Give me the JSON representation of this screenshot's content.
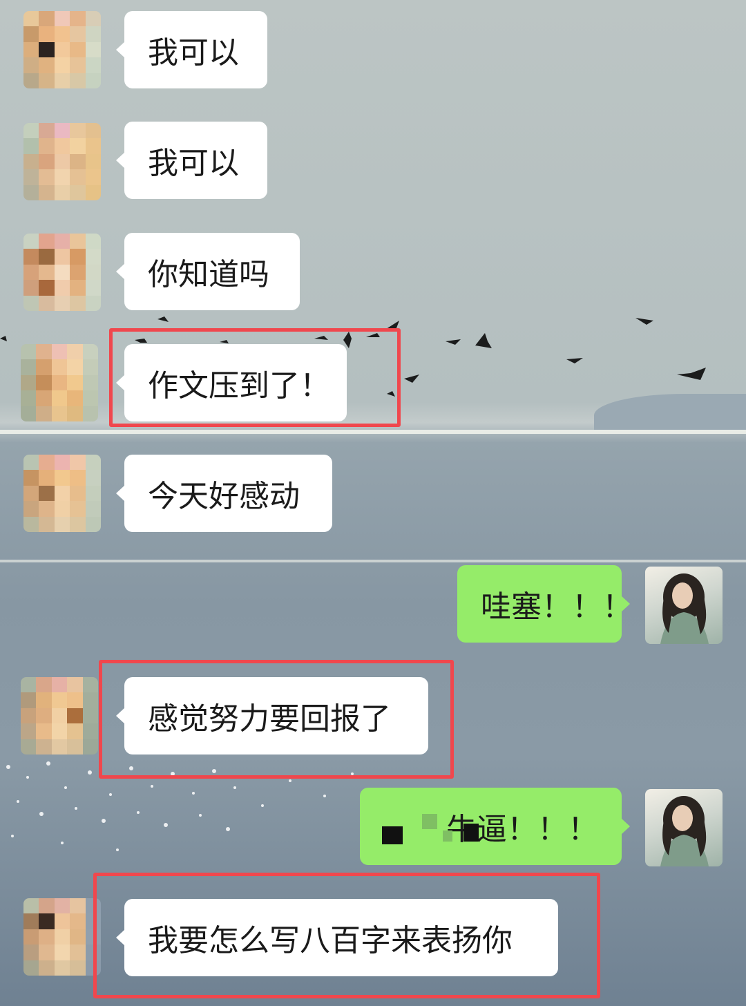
{
  "chat": {
    "messages": [
      {
        "side": "left",
        "text": "我可以"
      },
      {
        "side": "left",
        "text": "我可以"
      },
      {
        "side": "left",
        "text": "你知道吗"
      },
      {
        "side": "left",
        "text": "作文压到了！",
        "highlighted": true
      },
      {
        "side": "left",
        "text": "今天好感动"
      },
      {
        "side": "right",
        "text": "哇塞！！！"
      },
      {
        "side": "left",
        "text": "感觉努力要回报了",
        "highlighted": true
      },
      {
        "side": "right",
        "text": "牛逼！！！",
        "partially_redacted": true
      },
      {
        "side": "left",
        "text": "我要怎么写八百字来表扬你",
        "highlighted": true
      }
    ]
  },
  "colors": {
    "incoming_bubble": "#ffffff",
    "outgoing_bubble": "#95ec69",
    "highlight_box": "#f0474d"
  },
  "icons": {
    "contact_avatar": "pixelated-avatar-icon",
    "my_avatar": "portrait-avatar-icon"
  }
}
